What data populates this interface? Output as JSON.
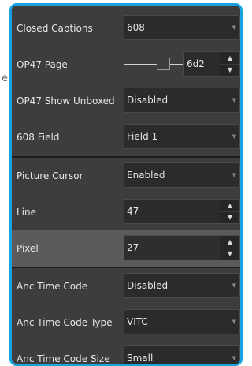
{
  "stray_text": "e",
  "settings": [
    {
      "label": "Closed Captions",
      "value": "608",
      "kind": "dropdown"
    },
    {
      "label": "OP47 Page",
      "value": "6d2",
      "kind": "slider-spinner"
    },
    {
      "label": "OP47 Show Unboxed",
      "value": "Disabled",
      "kind": "dropdown"
    },
    {
      "label": "608 Field",
      "value": "Field 1",
      "kind": "dropdown"
    },
    {
      "label": "Picture Cursor",
      "value": "Enabled",
      "kind": "dropdown"
    },
    {
      "label": "Line",
      "value": "47",
      "kind": "spinner"
    },
    {
      "label": "Pixel",
      "value": "27",
      "kind": "spinner",
      "selected": true
    },
    {
      "label": "Anc Time Code",
      "value": "Disabled",
      "kind": "dropdown"
    },
    {
      "label": "Anc Time Code Type",
      "value": "VITC",
      "kind": "dropdown"
    },
    {
      "label": "Anc Time Code Size",
      "value": "Small",
      "kind": "dropdown"
    }
  ],
  "icons": {
    "dropdown": "caret-down-icon",
    "spin_up": "spin-up-icon",
    "spin_down": "spin-down-icon"
  },
  "colors": {
    "panel_border": "#1aa2e0",
    "panel_bg": "#3d3d3d",
    "selected_row": "#5a5a5a"
  }
}
